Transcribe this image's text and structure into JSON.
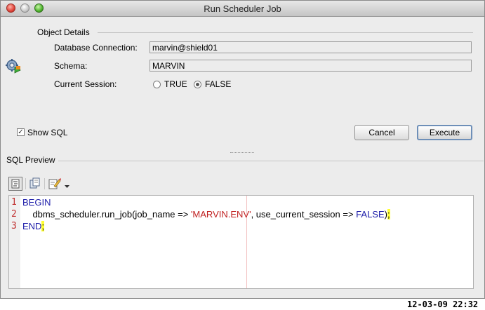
{
  "window": {
    "title": "Run Scheduler Job"
  },
  "object_details": {
    "section_label": "Object Details",
    "db_connection_label": "Database Connection:",
    "db_connection_value": "marvin@shield01",
    "schema_label": "Schema:",
    "schema_value": "MARVIN",
    "current_session_label": "Current Session:",
    "option_true": "TRUE",
    "option_false": "FALSE",
    "selected": "FALSE"
  },
  "show_sql": {
    "label": "Show SQL",
    "checked": true
  },
  "buttons": {
    "cancel": "Cancel",
    "execute": "Execute"
  },
  "sql_preview": {
    "section_label": "SQL Preview",
    "line_numbers": [
      "1",
      "2",
      "3"
    ],
    "line1_kw": "BEGIN",
    "line2_indent": "    dbms_scheduler.run_job(job_name => ",
    "line2_str": "'MARVIN.ENV'",
    "line2_mid": ", use_current_session => ",
    "line2_kw": "FALSE",
    "line2_end": ")",
    "line2_semi": ";",
    "line3_kw": "END",
    "line3_semi": ";"
  },
  "timestamp": "12-03-09 22:32",
  "icons": [
    "close-icon",
    "minimize-icon",
    "zoom-icon",
    "scheduler-job-icon",
    "format-icon",
    "copy-icon",
    "edit-icon",
    "dropdown-arrow-icon"
  ]
}
